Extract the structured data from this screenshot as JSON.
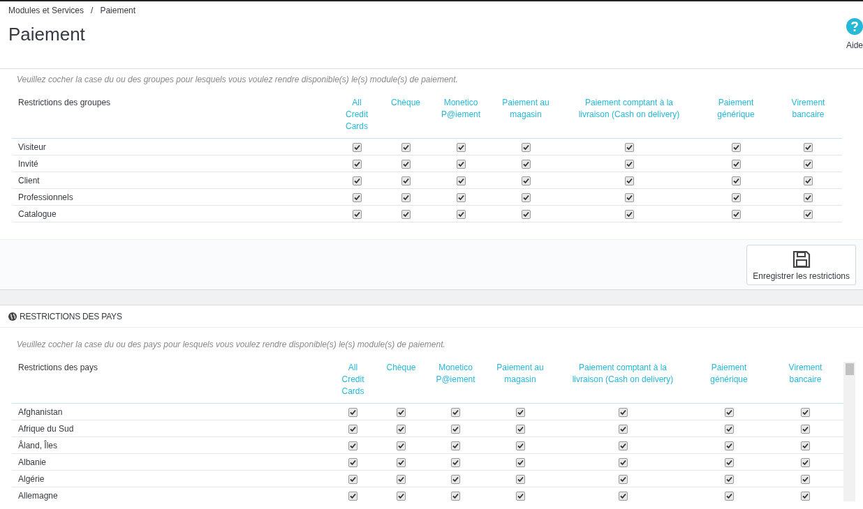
{
  "breadcrumb": {
    "items": [
      "Modules et Services",
      "Paiement"
    ],
    "separator": "/"
  },
  "title": "Paiement",
  "help": {
    "label": "Aide"
  },
  "group_restrictions": {
    "description": "Veuillez cocher la case du ou des groupes pour lesquels vous voulez rendre disponible(s) le(s) module(s) de paiement.",
    "row_header": "Restrictions des groupes",
    "columns": [
      "All Credit Cards",
      "Chèque",
      "Monetico P@iement",
      "Paiement au magasin",
      "Paiement comptant à la livraison (Cash on delivery)",
      "Paiement générique",
      "Virement bancaire"
    ],
    "rows": [
      {
        "name": "Visiteur",
        "checked": [
          true,
          true,
          true,
          true,
          true,
          true,
          true
        ]
      },
      {
        "name": "Invité",
        "checked": [
          true,
          true,
          true,
          true,
          true,
          true,
          true
        ]
      },
      {
        "name": "Client",
        "checked": [
          true,
          true,
          true,
          true,
          true,
          true,
          true
        ]
      },
      {
        "name": "Professionnels",
        "checked": [
          true,
          true,
          true,
          true,
          true,
          true,
          true
        ]
      },
      {
        "name": "Catalogue",
        "checked": [
          true,
          true,
          true,
          true,
          true,
          true,
          true
        ]
      }
    ]
  },
  "save_button": {
    "label": "Enregistrer les restrictions"
  },
  "country_restrictions": {
    "title": "RESTRICTIONS DES PAYS",
    "description": "Veuillez cocher la case du ou des pays pour lesquels vous voulez rendre disponible(s) le(s) module(s) de paiement.",
    "row_header": "Restrictions des pays",
    "columns": [
      "All Credit Cards",
      "Chèque",
      "Monetico P@iement",
      "Paiement au magasin",
      "Paiement comptant à la livraison (Cash on delivery)",
      "Paiement générique",
      "Virement bancaire"
    ],
    "rows": [
      {
        "name": "Afghanistan",
        "checked": [
          true,
          true,
          true,
          true,
          true,
          true,
          true
        ]
      },
      {
        "name": "Afrique du Sud",
        "checked": [
          true,
          true,
          true,
          true,
          true,
          true,
          true
        ]
      },
      {
        "name": "Åland, Îles",
        "checked": [
          true,
          true,
          true,
          true,
          true,
          true,
          true
        ]
      },
      {
        "name": "Albanie",
        "checked": [
          true,
          true,
          true,
          true,
          true,
          true,
          true
        ]
      },
      {
        "name": "Algérie",
        "checked": [
          true,
          true,
          true,
          true,
          true,
          true,
          true
        ]
      },
      {
        "name": "Allemagne",
        "checked": [
          true,
          true,
          true,
          true,
          true,
          true,
          true
        ]
      }
    ]
  }
}
